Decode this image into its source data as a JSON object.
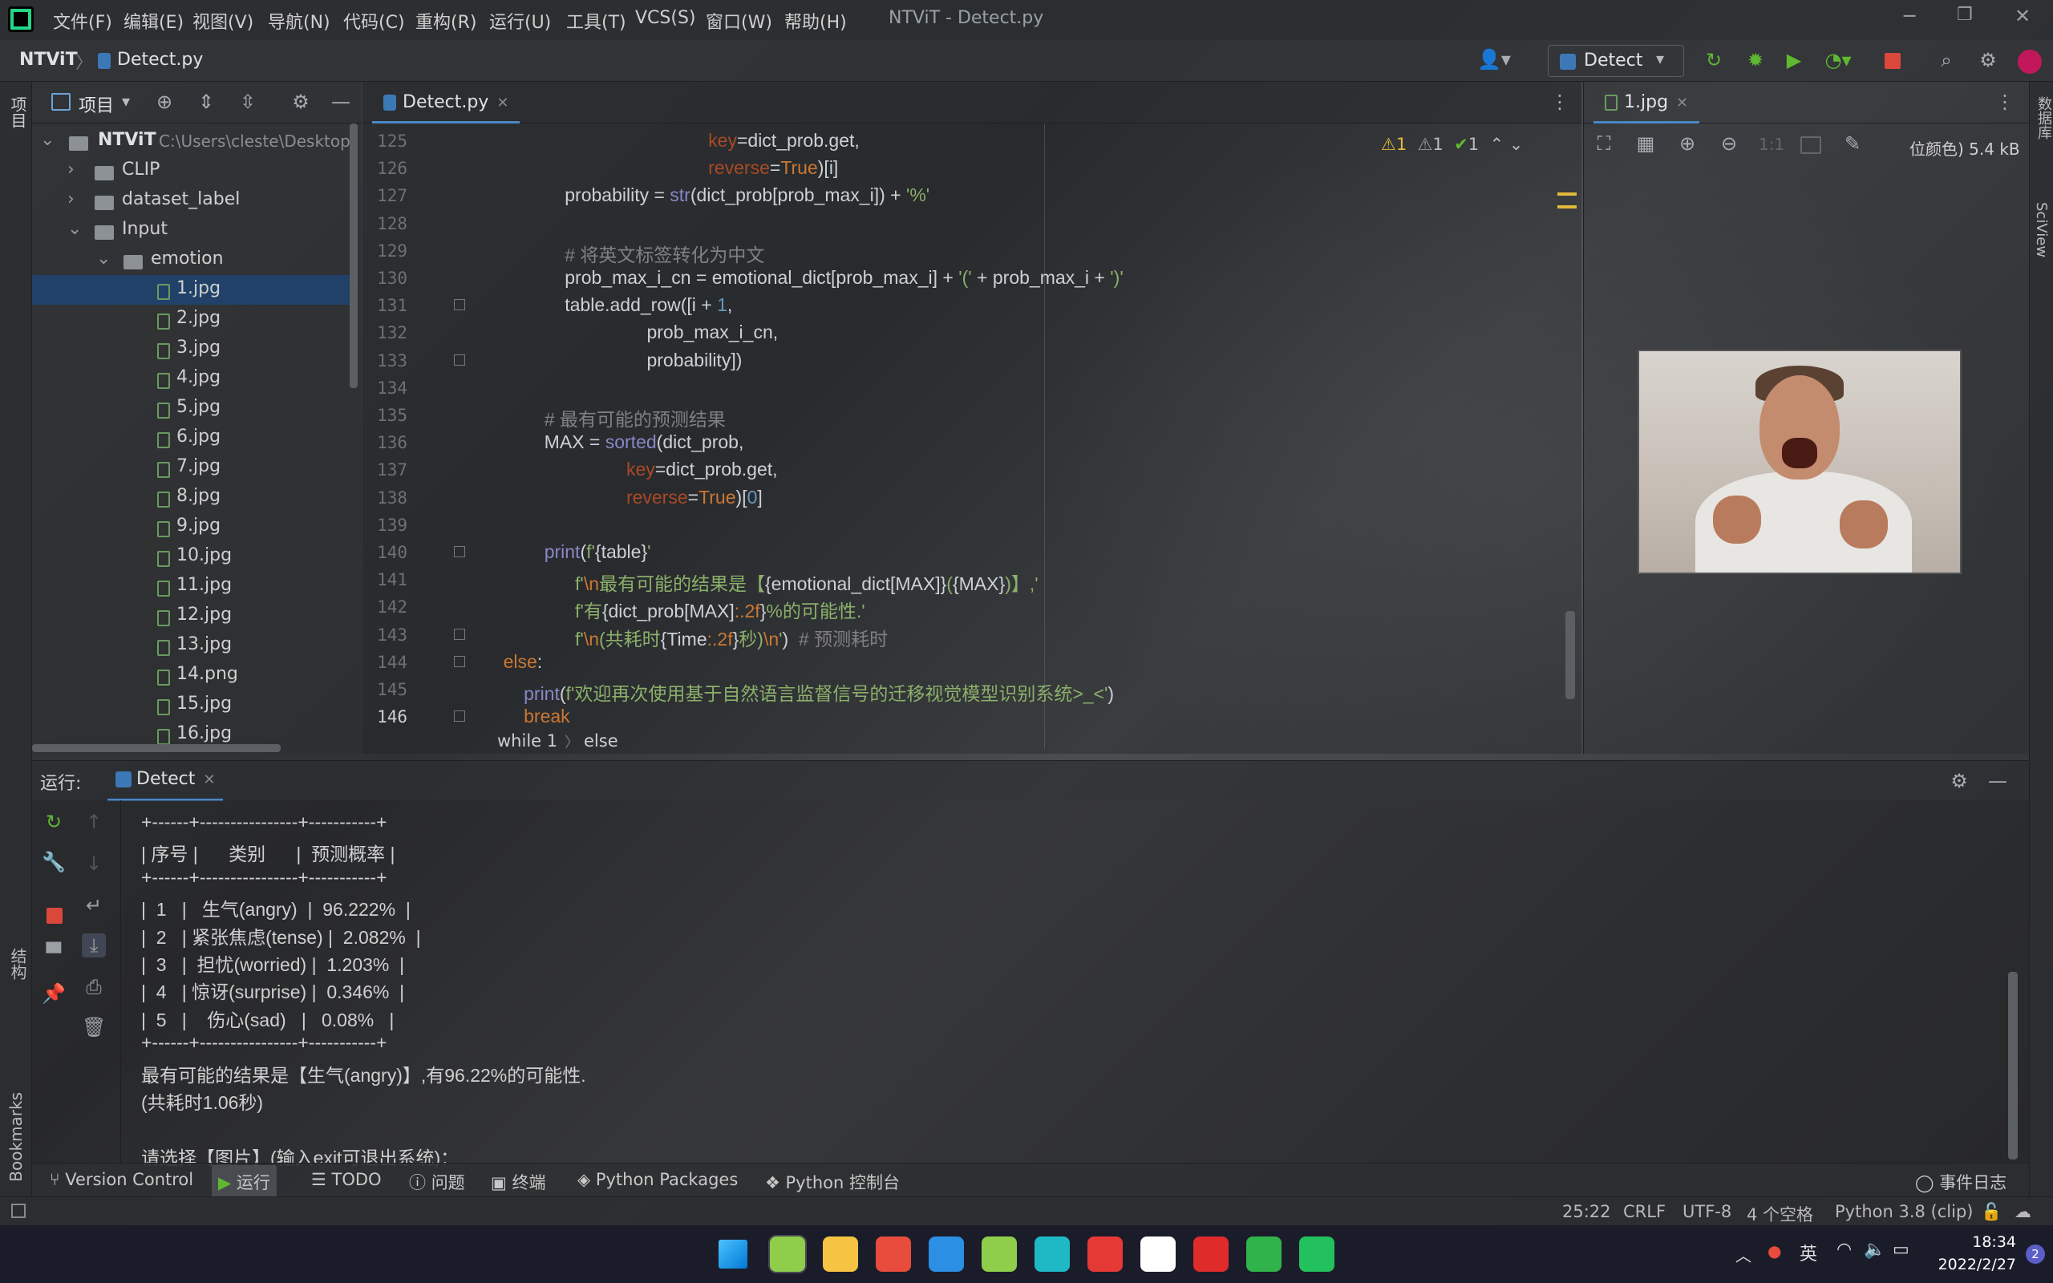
{
  "window": {
    "title": "NTViT - Detect.py",
    "min": "─",
    "max": "❐",
    "close": "✕"
  },
  "menu": [
    "文件(F)",
    "编辑(E)",
    "视图(V)",
    "导航(N)",
    "代码(C)",
    "重构(R)",
    "运行(U)",
    "工具(T)",
    "VCS(S)",
    "窗口(W)",
    "帮助(H)"
  ],
  "nav": {
    "project": "NTViT",
    "file": "Detect.py",
    "run_config": "Detect"
  },
  "project_panel": {
    "label": "项目",
    "root_name": "NTViT",
    "root_path": "C:\\Users\\cleste\\Desktop",
    "items": [
      {
        "label": "CLIP",
        "type": "folder",
        "level": 1,
        "expanded": false
      },
      {
        "label": "dataset_label",
        "type": "folder",
        "level": 1,
        "expanded": false
      },
      {
        "label": "Input",
        "type": "folder",
        "level": 1,
        "expanded": true
      },
      {
        "label": "emotion",
        "type": "folder",
        "level": 2,
        "expanded": true
      },
      {
        "label": "1.jpg",
        "type": "file",
        "level": 3,
        "selected": true
      },
      {
        "label": "2.jpg",
        "type": "file",
        "level": 3
      },
      {
        "label": "3.jpg",
        "type": "file",
        "level": 3
      },
      {
        "label": "4.jpg",
        "type": "file",
        "level": 3
      },
      {
        "label": "5.jpg",
        "type": "file",
        "level": 3
      },
      {
        "label": "6.jpg",
        "type": "file",
        "level": 3
      },
      {
        "label": "7.jpg",
        "type": "file",
        "level": 3
      },
      {
        "label": "8.jpg",
        "type": "file",
        "level": 3
      },
      {
        "label": "9.jpg",
        "type": "file",
        "level": 3
      },
      {
        "label": "10.jpg",
        "type": "file",
        "level": 3
      },
      {
        "label": "11.jpg",
        "type": "file",
        "level": 3
      },
      {
        "label": "12.jpg",
        "type": "file",
        "level": 3
      },
      {
        "label": "13.jpg",
        "type": "file",
        "level": 3
      },
      {
        "label": "14.png",
        "type": "file",
        "level": 3
      },
      {
        "label": "15.jpg",
        "type": "file",
        "level": 3
      },
      {
        "label": "16.jpg",
        "type": "file",
        "level": 3
      }
    ]
  },
  "editor": {
    "tab": "Detect.py",
    "inspections": {
      "warn1": "1",
      "warn2": "1",
      "ok": "1"
    },
    "lines": [
      {
        "n": "125",
        "html": "<span class='pr'>key</span>=dict_prob.get,",
        "indent": "                                            "
      },
      {
        "n": "126",
        "html": "<span class='pr'>reverse</span>=<span class='kw'>True</span>)[i]",
        "indent": "                                            "
      },
      {
        "n": "127",
        "html": "probability = <span class='fn'>str</span>(dict_prob[prob_max_i]) + <span class='str'>'%'</span>",
        "indent": "                "
      },
      {
        "n": "128",
        "html": "",
        "indent": ""
      },
      {
        "n": "129",
        "html": "<span class='cm'># 将英文标签转化为中文</span>",
        "indent": "                "
      },
      {
        "n": "130",
        "html": "prob_max_i_cn = emotional_dict[prob_max_i] + <span class='str'>'('</span> + prob_max_i + <span class='str'>')'</span>",
        "indent": "                "
      },
      {
        "n": "131",
        "html": "table.add_row([i + <span class='num'>1</span>,",
        "indent": "                "
      },
      {
        "n": "132",
        "html": "prob_max_i_cn,",
        "indent": "                                "
      },
      {
        "n": "133",
        "html": "probability])",
        "indent": "                                "
      },
      {
        "n": "134",
        "html": "",
        "indent": ""
      },
      {
        "n": "135",
        "html": "<span class='cm'># 最有可能的预测结果</span>",
        "indent": "            "
      },
      {
        "n": "136",
        "html": "MAX = <span class='fn'>sorted</span>(dict_prob,",
        "indent": "            "
      },
      {
        "n": "137",
        "html": "<span class='pr'>key</span>=dict_prob.get,",
        "indent": "                            "
      },
      {
        "n": "138",
        "html": "<span class='pr'>reverse</span>=<span class='kw'>True</span>)[<span class='num'>0</span>]",
        "indent": "                            "
      },
      {
        "n": "139",
        "html": "",
        "indent": ""
      },
      {
        "n": "140",
        "html": "<span class='fn'>print</span>(<span class='str'>f'</span>{table}<span class='str'>'</span>",
        "indent": "            "
      },
      {
        "n": "141",
        "html": "<span class='str'>f'</span><span class='kw'>\\n</span><span class='str'>最有可能的结果是【</span>{emotional_dict[MAX]}<span class='str'>(</span>{MAX}<span class='str'>)】,'</span>",
        "indent": "                  "
      },
      {
        "n": "142",
        "html": "<span class='str'>f'有</span>{dict_prob[MAX]<span class='kw'>:.2f</span>}<span class='str'>%的可能性.'</span>",
        "indent": "                  "
      },
      {
        "n": "143",
        "html": "<span class='str'>f'</span><span class='kw'>\\n</span><span class='str'>(共耗时</span>{Time<span class='kw'>:.2f</span>}<span class='str'>秒)</span><span class='kw'>\\n</span><span class='str'>'</span>)  <span class='cm'># 预测耗时</span>",
        "indent": "                  "
      },
      {
        "n": "144",
        "html": "<span class='kw'>else</span>:",
        "indent": "    "
      },
      {
        "n": "145",
        "html": "<span class='fn'>print</span>(<span class='str'>f'欢迎再次使用基于自然语言监督信号的迁移视觉模型识别系统&gt;_&lt;'</span>)",
        "indent": "        "
      },
      {
        "n": "146",
        "html": "<span class='kw'>break</span>",
        "indent": "        "
      }
    ],
    "breadcrumb": [
      "while 1",
      "else"
    ]
  },
  "image_viewer": {
    "tab": "1.jpg",
    "info": "位颜色) 5.4 kB",
    "ratio": "1:1"
  },
  "right_strip": [
    "数据库",
    "SciView"
  ],
  "left_strip": [
    "项目",
    "结构",
    "Bookmarks"
  ],
  "run": {
    "label": "运行:",
    "config": "Detect",
    "output": [
      "+------+----------------+-----------+",
      "| 序号 |      类别      |  预测概率 |",
      "+------+----------------+-----------+",
      "|  1   |   生气(angry)  |  96.222%  |",
      "|  2   | 紧张焦虑(tense) |  2.082%  |",
      "|  3   |  担忧(worried) |  1.203%  |",
      "|  4   | 惊讶(surprise) |  0.346%  |",
      "|  5   |    伤心(sad)   |   0.08%   |",
      "+------+----------------+-----------+",
      "最有可能的结果是【生气(angry)】,有96.22%的可能性.",
      "(共耗时1.06秒)",
      "",
      "请选择【图片】(输入exit可退出系统)："
    ]
  },
  "bottom_tabs": [
    "Version Control",
    "运行",
    "TODO",
    "问题",
    "终端",
    "Python Packages",
    "Python 控制台"
  ],
  "event_log": "事件日志",
  "status": {
    "pos": "25:22",
    "eol": "CRLF",
    "enc": "UTF-8",
    "indent": "4 个空格",
    "interp": "Python 3.8 (clip)"
  },
  "taskbar": {
    "time": "18:34",
    "date": "2022/2/27",
    "lang": "英",
    "notify": "2",
    "apps": [
      "windows-start",
      "pycharm",
      "file-explorer",
      "chrome",
      "vscode",
      "pycharm-ce",
      "edge",
      "wps",
      "typora",
      "youdao",
      "wechat-files",
      "wechat"
    ],
    "colors": {
      "win": "#3a9cf0",
      "pycharm": "#8fce4b",
      "explorer": "#f6c343",
      "chrome": "#e74c3c",
      "vscode": "#2b8fe3",
      "edge": "#1fb9c6",
      "wps": "#e53935",
      "typora": "#ffffff",
      "youdao": "#e02b2b",
      "files": "#2fb34a",
      "wechat": "#22c15e"
    }
  }
}
